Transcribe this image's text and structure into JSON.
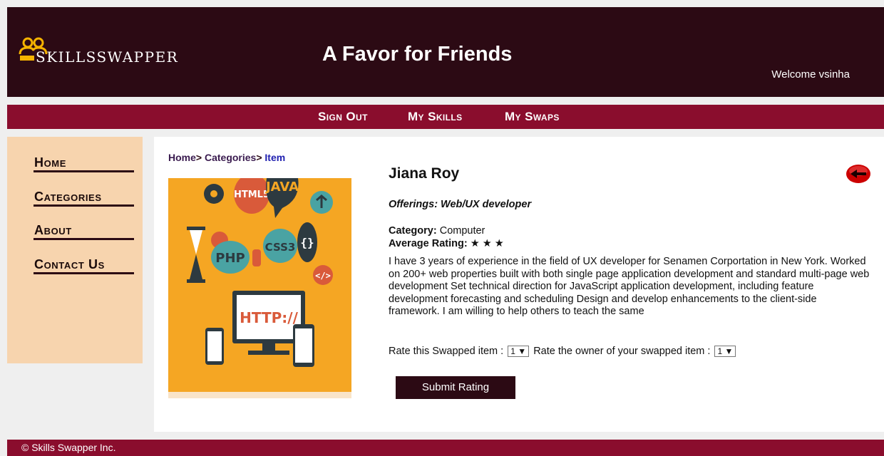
{
  "header": {
    "logo_text": "SKILLSSWAPPER",
    "title": "A Favor for Friends",
    "welcome": "Welcome vsinha"
  },
  "topnav": {
    "sign_out": "Sign Out",
    "my_skills": "My Skills",
    "my_swaps": "My Swaps"
  },
  "sidebar": {
    "items": [
      "Home",
      "Categories",
      "About",
      "Contact Us"
    ]
  },
  "breadcrumb": {
    "home": "Home",
    "categories": "Categories",
    "item": "Item"
  },
  "image_labels": {
    "html5": "HTML5",
    "java": "JAVA",
    "php": "PHP",
    "css3": "CSS3",
    "http": "HTTP://"
  },
  "item": {
    "owner_name": "Jiana Roy",
    "offerings": "Offerings: Web/UX developer",
    "category_label": "Category:",
    "category_value": "Computer",
    "rating_label": "Average Rating:",
    "rating_stars": "★ ★ ★",
    "description": "I have 3 years of experience in the field of UX developer for Senamen Corportation in New York. Worked on 200+ web properties built with both single page application development and standard multi-page web development Set technical direction for JavaScript application development, including feature development forecasting and scheduling Design and develop enhancements to the client-side framework. I am willing to help others to teach the same"
  },
  "rating_form": {
    "item_label": "Rate this Swapped item :",
    "item_value": "1",
    "owner_label": "Rate the owner of your swapped item :",
    "owner_value": "1",
    "submit_label": "Submit Rating"
  },
  "footer": {
    "text": "© Skills Swapper Inc."
  },
  "colors": {
    "header_bg": "#2c0a14",
    "nav_bg": "#8a0d2d",
    "sidebar_bg": "#f7d4ae",
    "image_bg": "#f5a623",
    "back_icon": "#cc0000"
  }
}
